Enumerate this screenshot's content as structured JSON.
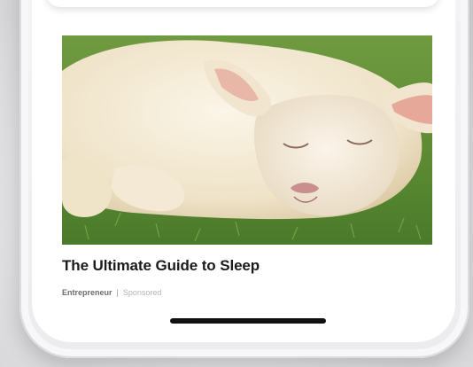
{
  "article": {
    "title": "The Ultimate Guide to Sleep",
    "source": "Entrepreneur",
    "separator": "|",
    "label": "Sponsored",
    "image_subject": "sleeping lamb on grass"
  },
  "colors": {
    "title": "#1b1b1b",
    "meta": "#8a8a8a",
    "home_indicator": "#111111",
    "grass": "#5f8a3a"
  }
}
